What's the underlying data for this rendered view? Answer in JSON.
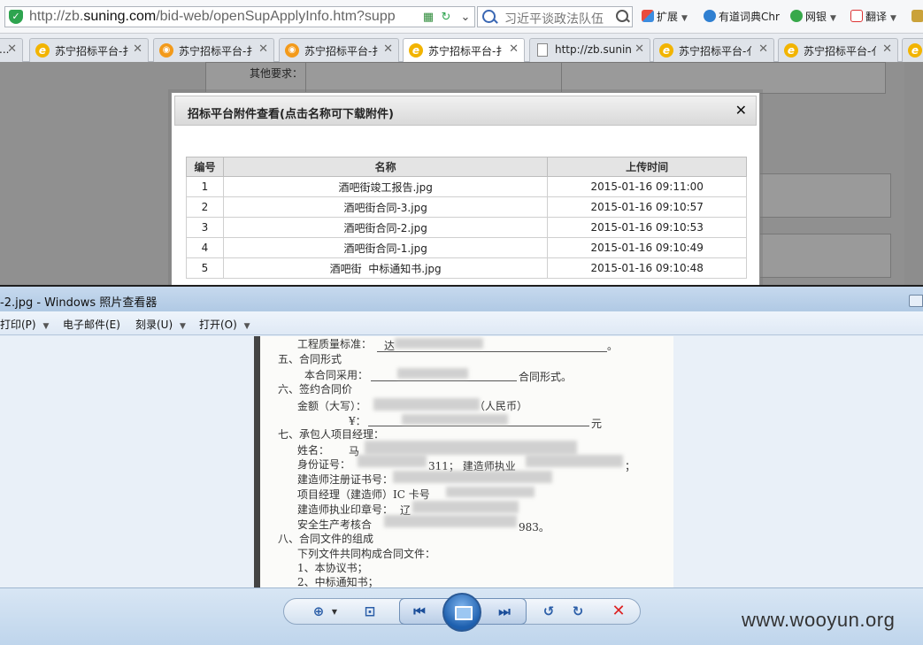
{
  "browser": {
    "url_prefix": "http://zb.",
    "url_domain": "suning.com",
    "url_rest": "/bid-web/openSupApplyInfo.htm?supp",
    "search_text": "习近平谈政法队伍",
    "toolbar": {
      "extensions": "扩展",
      "dictionary": "有道词典Chr",
      "bank": "网银",
      "translate": "翻译"
    },
    "tabs": [
      {
        "label": "...",
        "icon": "ie"
      },
      {
        "label": "苏宁招标平台-扌",
        "icon": "ie"
      },
      {
        "label": "苏宁招标平台-扌",
        "icon": "fox"
      },
      {
        "label": "苏宁招标平台-扌",
        "icon": "fox"
      },
      {
        "label": "苏宁招标平台-扌",
        "icon": "ie",
        "active": true
      },
      {
        "label": "http://zb.sunin",
        "icon": "page"
      },
      {
        "label": "苏宁招标平台-亻",
        "icon": "ie"
      },
      {
        "label": "苏宁招标平台-亻",
        "icon": "ie"
      }
    ]
  },
  "page": {
    "other_requirements_label": "其他要求："
  },
  "modal": {
    "title": "招标平台附件查看(点击名称可下载附件)",
    "columns": [
      "编号",
      "名称",
      "上传时间"
    ],
    "rows": [
      {
        "no": "1",
        "name": "酒吧街竣工报告.jpg",
        "time": "2015-01-16 09:11:00"
      },
      {
        "no": "2",
        "name": "酒吧街合同-3.jpg",
        "time": "2015-01-16 09:10:57"
      },
      {
        "no": "3",
        "name": "酒吧街合同-2.jpg",
        "time": "2015-01-16 09:10:53"
      },
      {
        "no": "4",
        "name": "酒吧街合同-1.jpg",
        "time": "2015-01-16 09:10:49"
      },
      {
        "no": "5",
        "name": "酒吧街  中标通知书.jpg",
        "time": "2015-01-16 09:10:48"
      }
    ]
  },
  "viewer": {
    "title": "-2.jpg - Windows 照片查看器",
    "menu": {
      "print": "打印(P)",
      "email": "电子邮件(E)",
      "burn": "刻录(U)",
      "open": "打开(O)"
    },
    "document_lines": {
      "l1": "工程质量标准：",
      "l1b": "达",
      "l2": "五、合同形式",
      "l3": "本合同采用：",
      "l3b": "合同形式。",
      "l4": "六、签约合同价",
      "l5": "金额（大写）：",
      "l5b": "（人民币）",
      "l6": "¥：",
      "l6b": "元",
      "l7": "七、承包人项目经理：",
      "l8": "姓名：",
      "l8b": "马",
      "l9": "身份证号：",
      "l9b": "311；  建造师执业",
      "l10": "建造师注册证书号：",
      "l11": "项目经理（建造师）IC 卡号",
      "l12": "建造师执业印章号：",
      "l12b": "辽",
      "l13": "安全生产考核合",
      "l13b": "983。",
      "l14": "八、合同文件的组成",
      "l15": "下列文件共同构成合同文件：",
      "l16": "1、本协议书；",
      "l17": "2、中标通知书；"
    }
  },
  "watermark": "www.wooyun.org"
}
